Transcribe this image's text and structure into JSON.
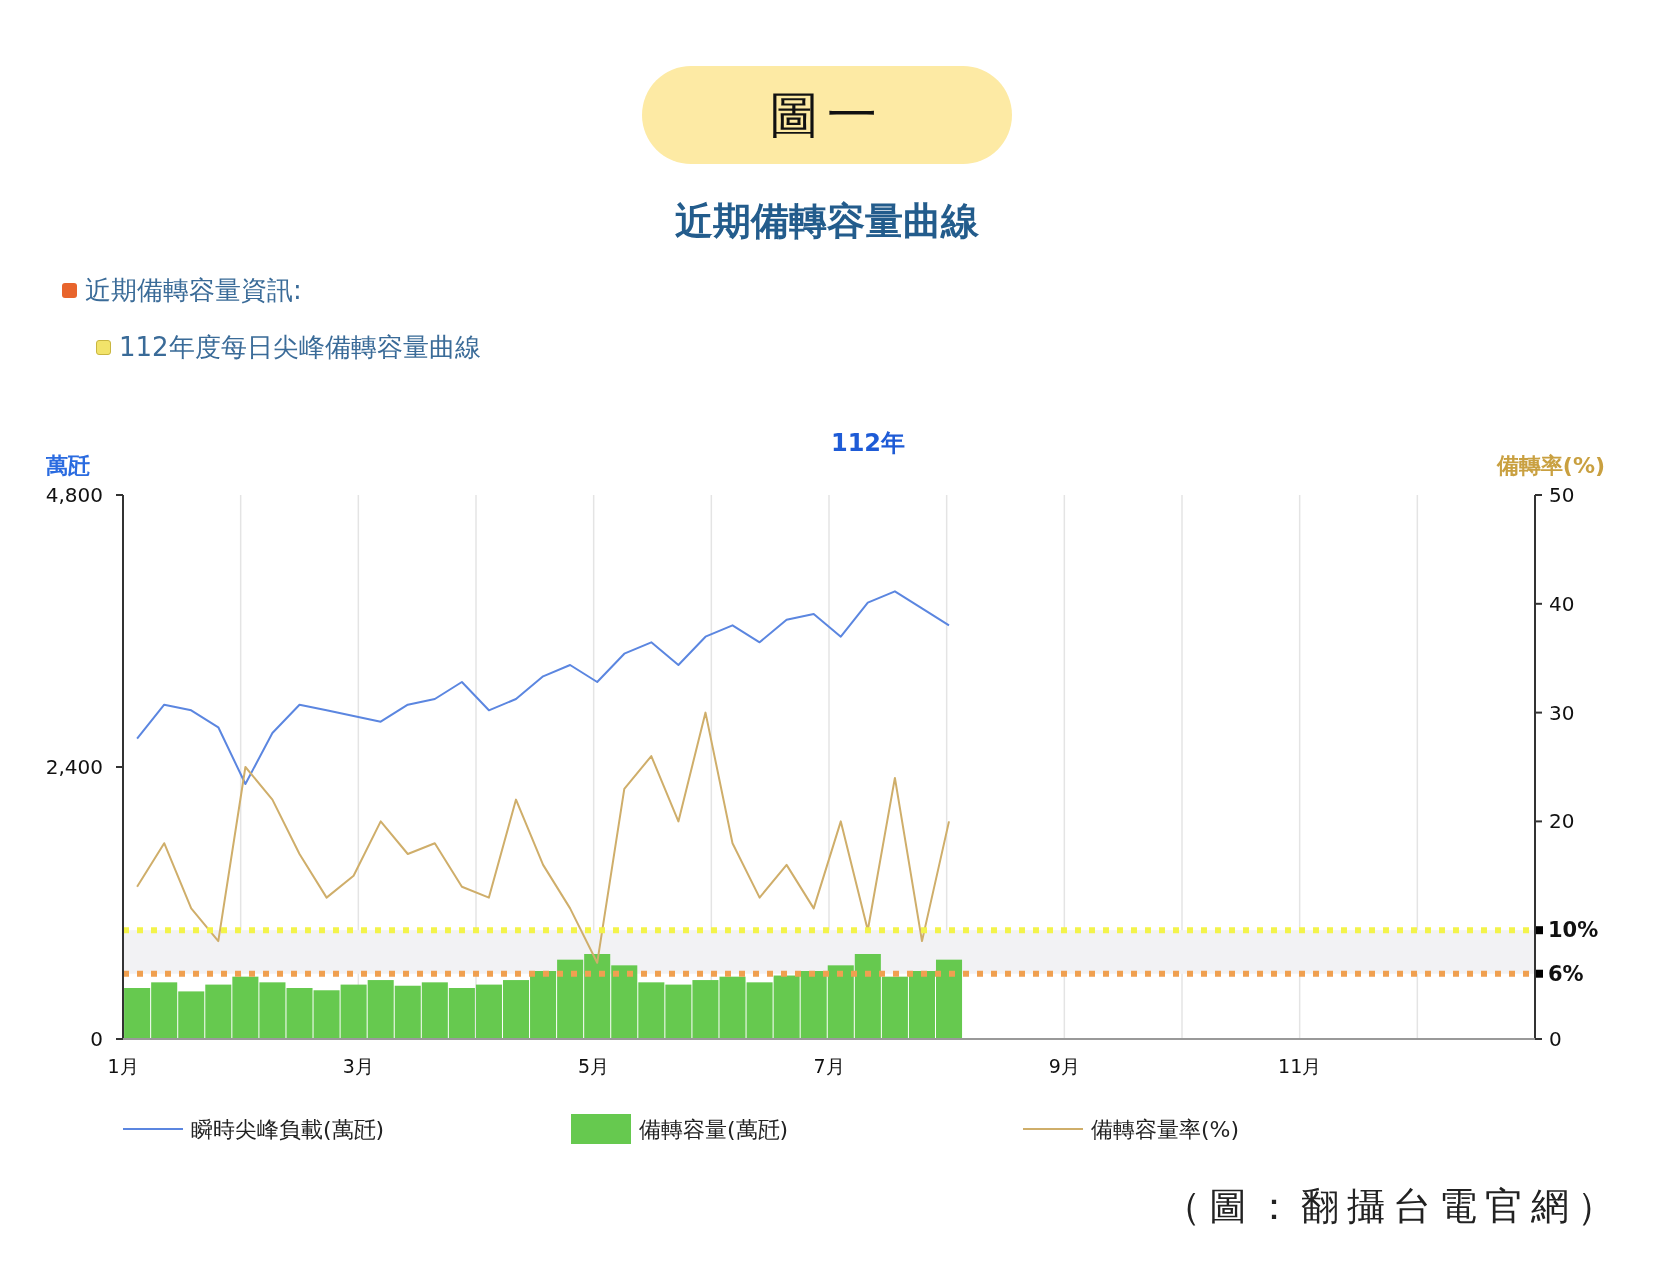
{
  "badge": "圖一",
  "title": "近期備轉容量曲線",
  "info_items": [
    {
      "text": "近期備轉容量資訊:",
      "color": "#e8642c",
      "children": [
        {
          "text": "112年度每日尖峰備轉容量曲線",
          "color": "#f2e36a"
        }
      ]
    }
  ],
  "chart": {
    "chart_data": {
      "type": "line",
      "title": "112年",
      "ylabel": "萬瓩",
      "y2label": "備轉率(%)",
      "x": [
        1.12,
        1.35,
        1.58,
        1.81,
        2.04,
        2.27,
        2.5,
        2.73,
        2.96,
        3.19,
        3.42,
        3.65,
        3.88,
        4.11,
        4.34,
        4.57,
        4.8,
        5.03,
        5.26,
        5.49,
        5.72,
        5.95,
        6.18,
        6.41,
        6.64,
        6.87,
        7.1,
        7.33,
        7.56,
        7.79,
        8.02
      ],
      "grid": true,
      "xlim": [
        1,
        13
      ],
      "ylim": [
        0,
        4800
      ],
      "y2lim": [
        0,
        50
      ],
      "xticks": [
        {
          "value": 1,
          "label": "1月"
        },
        {
          "value": 3,
          "label": "3月"
        },
        {
          "value": 5,
          "label": "5月"
        },
        {
          "value": 7,
          "label": "7月"
        },
        {
          "value": 9,
          "label": "9月"
        },
        {
          "value": 11,
          "label": "11月"
        }
      ],
      "yticks": [
        {
          "value": 0,
          "label": "0"
        },
        {
          "value": 2400,
          "label": "2,400"
        },
        {
          "value": 4800,
          "label": "4,800"
        }
      ],
      "y2ticks": [
        0,
        20,
        30,
        40,
        50
      ],
      "series": [
        {
          "name": "瞬時尖峰負載(萬瓩)",
          "color": "#5b86e0",
          "values": [
            2650,
            2950,
            2900,
            2750,
            2250,
            2700,
            2950,
            2900,
            2850,
            2800,
            2950,
            3000,
            3150,
            2900,
            3000,
            3200,
            3300,
            3150,
            3400,
            3500,
            3300,
            3550,
            3650,
            3500,
            3700,
            3750,
            3550,
            3850,
            3950,
            3800,
            3650
          ]
        },
        {
          "name": "備轉容量(萬瓩)",
          "type": "bar",
          "color": "#66c94f",
          "values": [
            450,
            500,
            420,
            480,
            550,
            500,
            450,
            430,
            480,
            520,
            470,
            500,
            450,
            480,
            520,
            600,
            700,
            750,
            650,
            500,
            480,
            520,
            550,
            500,
            560,
            600,
            650,
            750,
            550,
            600,
            700
          ]
        },
        {
          "name": "備轉容量率(%)",
          "axis": "y2",
          "color": "#cfae6a",
          "values": [
            14,
            18,
            12,
            9,
            25,
            22,
            17,
            13,
            15,
            20,
            17,
            18,
            14,
            13,
            22,
            16,
            12,
            7,
            23,
            26,
            20,
            30,
            18,
            13,
            16,
            12,
            20,
            10,
            24,
            9,
            20
          ]
        }
      ],
      "ref_lines": [
        {
          "value": 10,
          "axis": "y2",
          "label": "10%",
          "color": "#f3f34a"
        },
        {
          "value": 6,
          "axis": "y2",
          "label": "6%",
          "color": "#f0a050"
        }
      ],
      "bands": [
        {
          "from": 6,
          "to": 10,
          "axis": "y2",
          "color": "#f2f2f4"
        }
      ],
      "legend": "bottom"
    }
  },
  "caption": "（圖：翻攝台電官網）"
}
